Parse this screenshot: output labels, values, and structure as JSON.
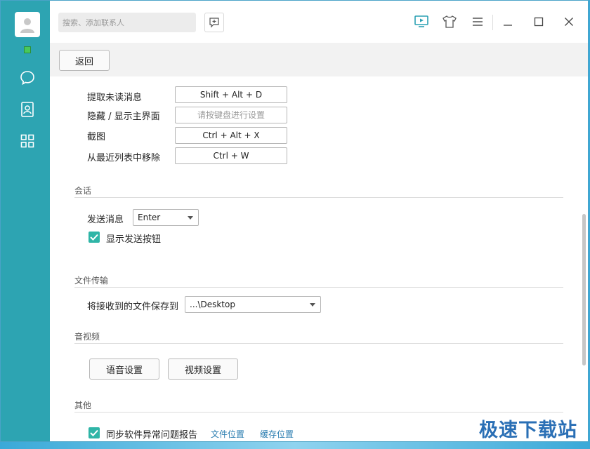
{
  "search": {
    "placeholder": "搜索、添加联系人"
  },
  "subbar": {
    "back_label": "返回"
  },
  "shortcuts": [
    {
      "label": "提取未读消息",
      "value": "Shift + Alt + D",
      "placeholder": false
    },
    {
      "label": "隐藏 / 显示主界面",
      "value": "请按键盘进行设置",
      "placeholder": true
    },
    {
      "label": "截图",
      "value": "Ctrl + Alt + X",
      "placeholder": false
    },
    {
      "label": "从最近列表中移除",
      "value": "Ctrl + W",
      "placeholder": false
    }
  ],
  "session": {
    "title": "会话",
    "send_label": "发送消息",
    "send_value": "Enter",
    "show_send_button_label": "显示发送按钮"
  },
  "file_transfer": {
    "title": "文件传输",
    "save_to_label": "将接收到的文件保存到",
    "save_to_value": "...\\Desktop"
  },
  "av": {
    "title": "音视频",
    "voice_label": "语音设置",
    "video_label": "视频设置"
  },
  "other": {
    "title": "其他",
    "sync_report_label": "同步软件异常问题报告",
    "file_location_link": "文件位置",
    "cache_location_link": "缓存位置"
  },
  "watermark": "极速下载站",
  "colors": {
    "sidebar": "#2da4b2",
    "accent": "#2fb5a7",
    "status_online": "#49c85a",
    "link": "#2a7db0"
  }
}
